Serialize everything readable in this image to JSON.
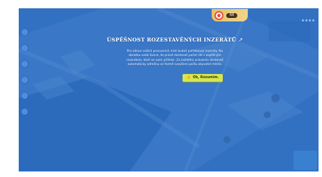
{
  "dialog": {
    "title": "ÚSPĚŠNOST ROZESTAVĚNÝCH INZERÁTŮ",
    "body": "Pro zdraví vašich pracovních míst budeš potřebovat inzeráty. Na obrázku vede šance, že právě dostaneš počet lidí s úspěšným inzerátem, kteří se sami přihlásí. Za každého uchazeče dostaneš automaticky odměnu ve formě navýšení počtu obyvatel města.",
    "ok_label": "Ok, Rozumím."
  },
  "badge": {
    "pill_label": "68"
  },
  "icons": {
    "title": "leaf-icon",
    "ok": "thumbs-up-icon",
    "badge": "target-icon"
  },
  "colors": {
    "overlay": "#2f74c1",
    "button": "#d8e64a",
    "badge": "#e7c06a"
  }
}
